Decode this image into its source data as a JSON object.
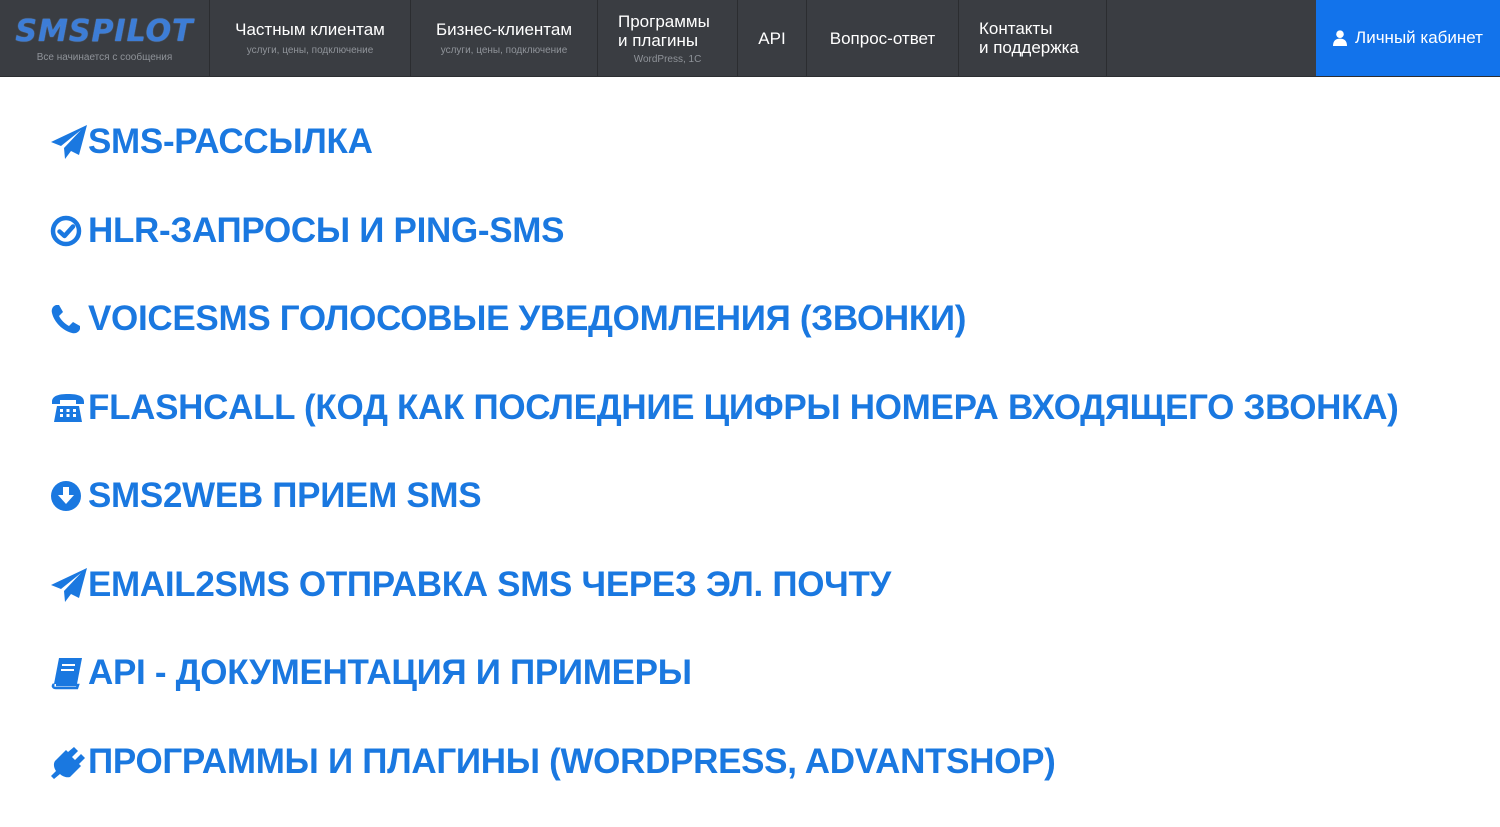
{
  "header": {
    "logo": "SMSPILOT",
    "tagline": "Все начинается с сообщения",
    "nav": [
      {
        "title": "Частным клиентам",
        "subtitle": "услуги, цены, подключение"
      },
      {
        "title": "Бизнес-клиентам",
        "subtitle": "услуги, цены, подключение"
      },
      {
        "title": "Программы\nи плагины",
        "subtitle": "WordPress, 1C"
      },
      {
        "title": "API"
      },
      {
        "title": "Вопрос-ответ"
      },
      {
        "title": "Контакты\nи поддержка"
      }
    ],
    "account_button": "Личный кабинет"
  },
  "menu": [
    {
      "icon": "paper-plane-icon",
      "label": "SMS-РАССЫЛКА"
    },
    {
      "icon": "check-circle-icon",
      "label": "HLR-ЗАПРОСЫ И PING-SMS"
    },
    {
      "icon": "phone-icon",
      "label": "VOICESMS ГОЛОСОВЫЕ УВЕДОМЛЕНИЯ (ЗВОНКИ)"
    },
    {
      "icon": "desk-phone-icon",
      "label": "FLASHCALL (КОД КАК ПОСЛЕДНИЕ ЦИФРЫ НОМЕРА ВХОДЯЩЕГО ЗВОНКА)"
    },
    {
      "icon": "download-circle-icon",
      "label": "SMS2WEB ПРИЕМ SMS"
    },
    {
      "icon": "paper-plane-icon",
      "label": "EMAIL2SMS ОТПРАВКА SMS ЧЕРЕЗ ЭЛ. ПОЧТУ"
    },
    {
      "icon": "book-icon",
      "label": "API - ДОКУМЕНТАЦИЯ И ПРИМЕРЫ"
    },
    {
      "icon": "plug-icon",
      "label": "ПРОГРАММЫ И ПЛАГИНЫ (WORDPRESS, ADVANTSHOP)"
    }
  ],
  "colors": {
    "navbar_bg": "#3a3d42",
    "accent_blue": "#1273eb",
    "link_blue": "#1a78e0"
  }
}
